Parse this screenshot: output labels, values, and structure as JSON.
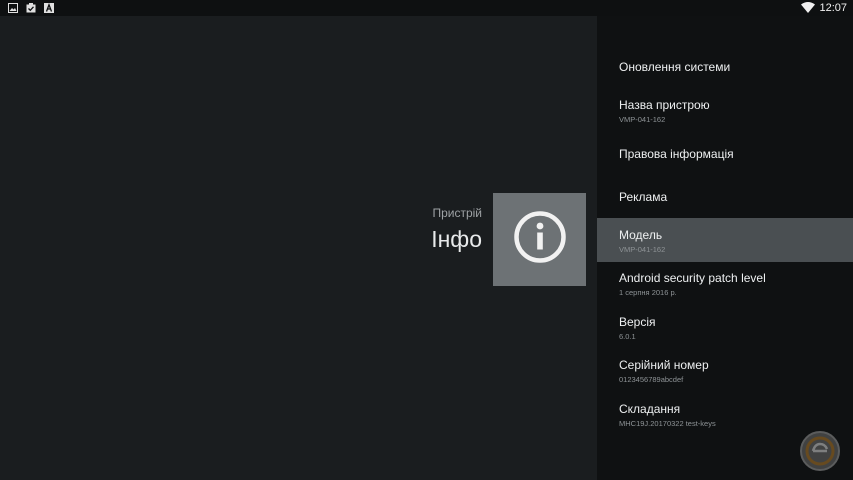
{
  "status_bar": {
    "icons": [
      "image-icon",
      "clipboard-check-icon",
      "letter-a-icon",
      "wifi-icon"
    ],
    "time": "12:07"
  },
  "header": {
    "subtitle": "Пристрій",
    "title": "Інфо",
    "icon": "info-icon"
  },
  "menu": {
    "items": [
      {
        "title": "Оновлення системи",
        "subtitle": ""
      },
      {
        "title": "Назва пристрою",
        "subtitle": "VMP-041-162"
      },
      {
        "title": "Правова інформація",
        "subtitle": ""
      },
      {
        "title": "Реклама",
        "subtitle": ""
      },
      {
        "title": "Модель",
        "subtitle": "VMP-041-162"
      },
      {
        "title": "Android security patch level",
        "subtitle": "1 серпня 2016 р."
      },
      {
        "title": "Версія",
        "subtitle": "6.0.1"
      },
      {
        "title": "Серійний номер",
        "subtitle": "0123456789abcdef"
      },
      {
        "title": "Складання",
        "subtitle": "MHC19J.20170322 test-keys"
      }
    ],
    "selected_index": 4
  },
  "colors": {
    "background": "#1a1d1f",
    "panel": "#0f1112",
    "selected": "#4a4f52",
    "tile": "#6d7275"
  }
}
